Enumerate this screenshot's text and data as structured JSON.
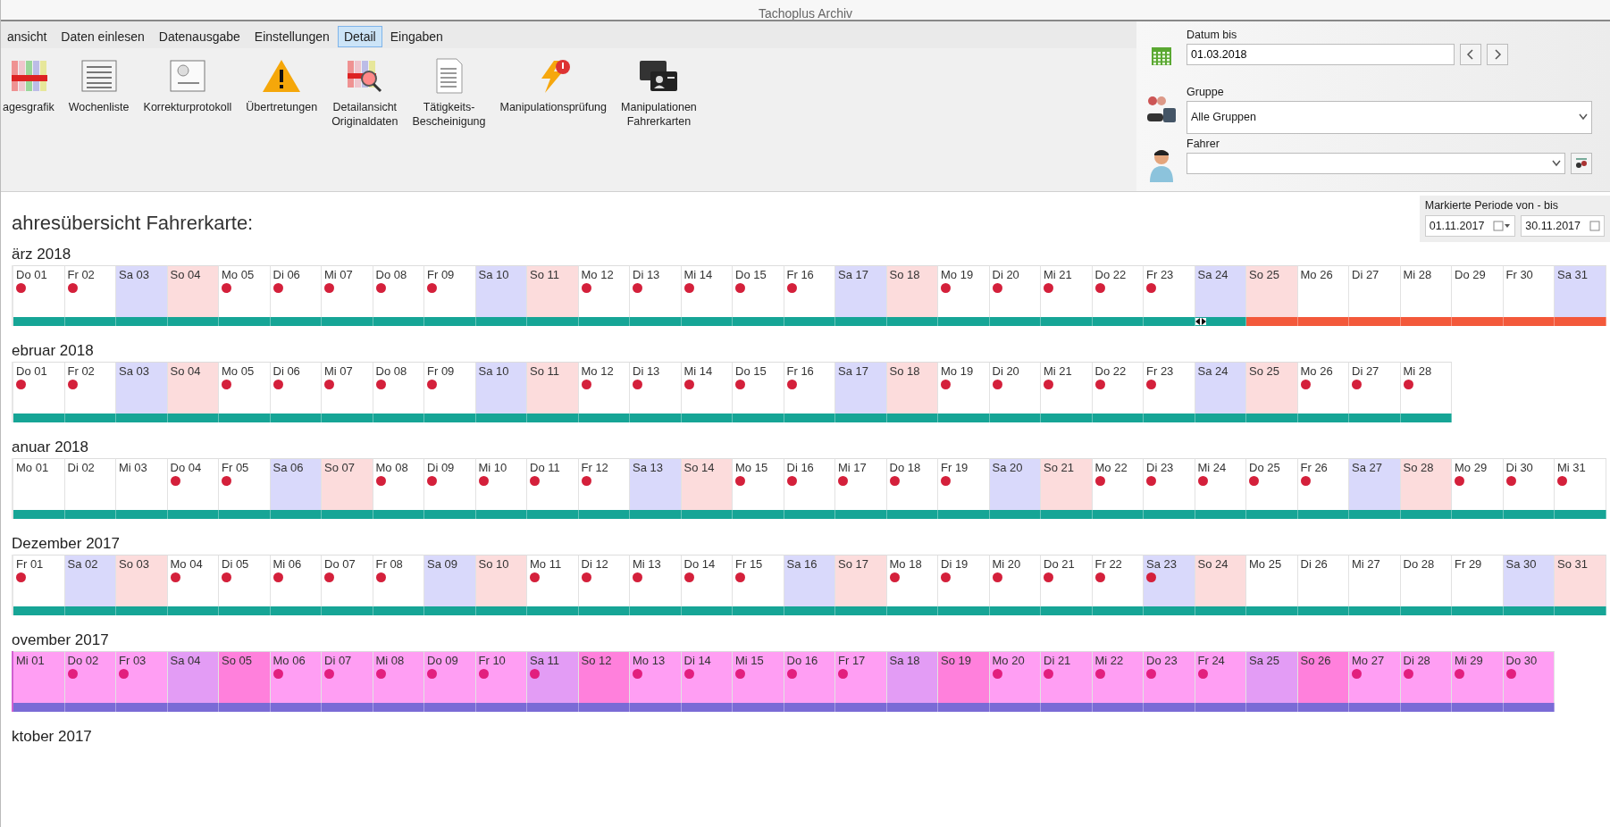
{
  "window": {
    "title": "Tachoplus Archiv"
  },
  "menu_tabs": [
    {
      "label": "ansicht",
      "selected": false
    },
    {
      "label": "Daten einlesen",
      "selected": false
    },
    {
      "label": "Datenausgabe",
      "selected": false
    },
    {
      "label": "Einstellungen",
      "selected": false
    },
    {
      "label": "Detail",
      "selected": true
    },
    {
      "label": "Eingaben",
      "selected": false
    }
  ],
  "toolbar": [
    {
      "kind": "day-chart",
      "lines": [
        "agesgrafik"
      ]
    },
    {
      "kind": "week-list",
      "lines": [
        "Wochenliste"
      ]
    },
    {
      "kind": "correction-log",
      "lines": [
        "Korrekturprotokoll"
      ]
    },
    {
      "kind": "warning",
      "lines": [
        "Übertretungen"
      ]
    },
    {
      "kind": "detail-view",
      "lines": [
        "Detailansicht",
        "Originaldaten"
      ]
    },
    {
      "kind": "certificate",
      "lines": [
        "Tätigkeits-",
        "Bescheinigung"
      ]
    },
    {
      "kind": "manipulation-check",
      "lines": [
        "Manipulationsprüfung"
      ]
    },
    {
      "kind": "driver-cards",
      "lines": [
        "Manipulationen",
        "Fahrerkarten"
      ]
    }
  ],
  "filters": {
    "date_to": {
      "label": "Datum bis",
      "value": "01.03.2018"
    },
    "group": {
      "label": "Gruppe",
      "value": "Alle Gruppen"
    },
    "driver": {
      "label": "Fahrer"
    }
  },
  "period": {
    "label": "Markierte Periode von - bis",
    "from": "01.11.2017",
    "to": "30.11.2017"
  },
  "overview": {
    "title": "ahresübersicht Fahrerkarte:",
    "months": [
      {
        "title": "ärz 2018",
        "marked": false,
        "days": [
          {
            "label": "Do 01",
            "kind": "weekday",
            "alert": true,
            "recorded": true
          },
          {
            "label": "Fr 02",
            "kind": "weekday",
            "alert": true,
            "recorded": true
          },
          {
            "label": "Sa 03",
            "kind": "saturday",
            "alert": false,
            "recorded": true
          },
          {
            "label": "So 04",
            "kind": "sunday",
            "alert": false,
            "recorded": true
          },
          {
            "label": "Mo 05",
            "kind": "weekday",
            "alert": true,
            "recorded": true
          },
          {
            "label": "Di 06",
            "kind": "weekday",
            "alert": true,
            "recorded": true
          },
          {
            "label": "Mi 07",
            "kind": "weekday",
            "alert": true,
            "recorded": true
          },
          {
            "label": "Do 08",
            "kind": "weekday",
            "alert": true,
            "recorded": true
          },
          {
            "label": "Fr 09",
            "kind": "weekday",
            "alert": true,
            "recorded": true
          },
          {
            "label": "Sa 10",
            "kind": "saturday",
            "alert": false,
            "recorded": true
          },
          {
            "label": "So 11",
            "kind": "sunday",
            "alert": false,
            "recorded": true
          },
          {
            "label": "Mo 12",
            "kind": "weekday",
            "alert": true,
            "recorded": true
          },
          {
            "label": "Di 13",
            "kind": "weekday",
            "alert": true,
            "recorded": true
          },
          {
            "label": "Mi 14",
            "kind": "weekday",
            "alert": true,
            "recorded": true
          },
          {
            "label": "Do 15",
            "kind": "weekday",
            "alert": true,
            "recorded": true
          },
          {
            "label": "Fr 16",
            "kind": "weekday",
            "alert": true,
            "recorded": true
          },
          {
            "label": "Sa 17",
            "kind": "saturday",
            "alert": false,
            "recorded": true
          },
          {
            "label": "So 18",
            "kind": "sunday",
            "alert": false,
            "recorded": true
          },
          {
            "label": "Mo 19",
            "kind": "weekday",
            "alert": true,
            "recorded": true
          },
          {
            "label": "Di 20",
            "kind": "weekday",
            "alert": true,
            "recorded": true
          },
          {
            "label": "Mi 21",
            "kind": "weekday",
            "alert": true,
            "recorded": true
          },
          {
            "label": "Do 22",
            "kind": "weekday",
            "alert": true,
            "recorded": true
          },
          {
            "label": "Fr 23",
            "kind": "weekday",
            "alert": true,
            "recorded": true
          },
          {
            "label": "Sa 24",
            "kind": "saturday",
            "alert": false,
            "recorded": true,
            "transition": true
          },
          {
            "label": "So 25",
            "kind": "sunday",
            "alert": false,
            "recorded": false
          },
          {
            "label": "Mo 26",
            "kind": "weekday",
            "alert": false,
            "recorded": false
          },
          {
            "label": "Di 27",
            "kind": "weekday",
            "alert": false,
            "recorded": false
          },
          {
            "label": "Mi 28",
            "kind": "weekday",
            "alert": false,
            "recorded": false
          },
          {
            "label": "Do 29",
            "kind": "weekday",
            "alert": false,
            "recorded": false
          },
          {
            "label": "Fr 30",
            "kind": "weekday",
            "alert": false,
            "recorded": false
          },
          {
            "label": "Sa 31",
            "kind": "saturday",
            "alert": false,
            "recorded": false
          }
        ]
      },
      {
        "title": "ebruar 2018",
        "marked": false,
        "days": [
          {
            "label": "Do 01",
            "kind": "weekday",
            "alert": true,
            "recorded": true
          },
          {
            "label": "Fr 02",
            "kind": "weekday",
            "alert": true,
            "recorded": true
          },
          {
            "label": "Sa 03",
            "kind": "saturday",
            "alert": false,
            "recorded": true
          },
          {
            "label": "So 04",
            "kind": "sunday",
            "alert": false,
            "recorded": true
          },
          {
            "label": "Mo 05",
            "kind": "weekday",
            "alert": true,
            "recorded": true
          },
          {
            "label": "Di 06",
            "kind": "weekday",
            "alert": true,
            "recorded": true
          },
          {
            "label": "Mi 07",
            "kind": "weekday",
            "alert": true,
            "recorded": true
          },
          {
            "label": "Do 08",
            "kind": "weekday",
            "alert": true,
            "recorded": true
          },
          {
            "label": "Fr 09",
            "kind": "weekday",
            "alert": true,
            "recorded": true
          },
          {
            "label": "Sa 10",
            "kind": "saturday",
            "alert": false,
            "recorded": true
          },
          {
            "label": "So 11",
            "kind": "sunday",
            "alert": false,
            "recorded": true
          },
          {
            "label": "Mo 12",
            "kind": "weekday",
            "alert": true,
            "recorded": true
          },
          {
            "label": "Di 13",
            "kind": "weekday",
            "alert": true,
            "recorded": true
          },
          {
            "label": "Mi 14",
            "kind": "weekday",
            "alert": true,
            "recorded": true
          },
          {
            "label": "Do 15",
            "kind": "weekday",
            "alert": true,
            "recorded": true
          },
          {
            "label": "Fr 16",
            "kind": "weekday",
            "alert": true,
            "recorded": true
          },
          {
            "label": "Sa 17",
            "kind": "saturday",
            "alert": false,
            "recorded": true
          },
          {
            "label": "So 18",
            "kind": "sunday",
            "alert": false,
            "recorded": true
          },
          {
            "label": "Mo 19",
            "kind": "weekday",
            "alert": true,
            "recorded": true
          },
          {
            "label": "Di 20",
            "kind": "weekday",
            "alert": true,
            "recorded": true
          },
          {
            "label": "Mi 21",
            "kind": "weekday",
            "alert": true,
            "recorded": true
          },
          {
            "label": "Do 22",
            "kind": "weekday",
            "alert": true,
            "recorded": true
          },
          {
            "label": "Fr 23",
            "kind": "weekday",
            "alert": true,
            "recorded": true
          },
          {
            "label": "Sa 24",
            "kind": "saturday",
            "alert": false,
            "recorded": true
          },
          {
            "label": "So 25",
            "kind": "sunday",
            "alert": false,
            "recorded": true
          },
          {
            "label": "Mo 26",
            "kind": "weekday",
            "alert": true,
            "recorded": true
          },
          {
            "label": "Di 27",
            "kind": "weekday",
            "alert": true,
            "recorded": true
          },
          {
            "label": "Mi 28",
            "kind": "weekday",
            "alert": true,
            "recorded": true
          }
        ]
      },
      {
        "title": "anuar 2018",
        "marked": false,
        "days": [
          {
            "label": "Mo 01",
            "kind": "weekday",
            "alert": false,
            "recorded": true
          },
          {
            "label": "Di 02",
            "kind": "weekday",
            "alert": false,
            "recorded": true
          },
          {
            "label": "Mi 03",
            "kind": "weekday",
            "alert": false,
            "recorded": true
          },
          {
            "label": "Do 04",
            "kind": "weekday",
            "alert": true,
            "recorded": true
          },
          {
            "label": "Fr 05",
            "kind": "weekday",
            "alert": true,
            "recorded": true
          },
          {
            "label": "Sa 06",
            "kind": "saturday",
            "alert": false,
            "recorded": true
          },
          {
            "label": "So 07",
            "kind": "sunday",
            "alert": false,
            "recorded": true
          },
          {
            "label": "Mo 08",
            "kind": "weekday",
            "alert": true,
            "recorded": true
          },
          {
            "label": "Di 09",
            "kind": "weekday",
            "alert": true,
            "recorded": true
          },
          {
            "label": "Mi 10",
            "kind": "weekday",
            "alert": true,
            "recorded": true
          },
          {
            "label": "Do 11",
            "kind": "weekday",
            "alert": true,
            "recorded": true
          },
          {
            "label": "Fr 12",
            "kind": "weekday",
            "alert": true,
            "recorded": true
          },
          {
            "label": "Sa 13",
            "kind": "saturday",
            "alert": false,
            "recorded": true
          },
          {
            "label": "So 14",
            "kind": "sunday",
            "alert": false,
            "recorded": true
          },
          {
            "label": "Mo 15",
            "kind": "weekday",
            "alert": true,
            "recorded": true
          },
          {
            "label": "Di 16",
            "kind": "weekday",
            "alert": true,
            "recorded": true
          },
          {
            "label": "Mi 17",
            "kind": "weekday",
            "alert": true,
            "recorded": true
          },
          {
            "label": "Do 18",
            "kind": "weekday",
            "alert": true,
            "recorded": true
          },
          {
            "label": "Fr 19",
            "kind": "weekday",
            "alert": true,
            "recorded": true
          },
          {
            "label": "Sa 20",
            "kind": "saturday",
            "alert": false,
            "recorded": true
          },
          {
            "label": "So 21",
            "kind": "sunday",
            "alert": false,
            "recorded": true
          },
          {
            "label": "Mo 22",
            "kind": "weekday",
            "alert": true,
            "recorded": true
          },
          {
            "label": "Di 23",
            "kind": "weekday",
            "alert": true,
            "recorded": true
          },
          {
            "label": "Mi 24",
            "kind": "weekday",
            "alert": true,
            "recorded": true
          },
          {
            "label": "Do 25",
            "kind": "weekday",
            "alert": true,
            "recorded": true
          },
          {
            "label": "Fr 26",
            "kind": "weekday",
            "alert": true,
            "recorded": true
          },
          {
            "label": "Sa 27",
            "kind": "saturday",
            "alert": false,
            "recorded": true
          },
          {
            "label": "So 28",
            "kind": "sunday",
            "alert": false,
            "recorded": true
          },
          {
            "label": "Mo 29",
            "kind": "weekday",
            "alert": true,
            "recorded": true
          },
          {
            "label": "Di 30",
            "kind": "weekday",
            "alert": true,
            "recorded": true
          },
          {
            "label": "Mi 31",
            "kind": "weekday",
            "alert": true,
            "recorded": true
          }
        ]
      },
      {
        "title": "Dezember 2017",
        "marked": false,
        "days": [
          {
            "label": "Fr 01",
            "kind": "weekday",
            "alert": true,
            "recorded": true
          },
          {
            "label": "Sa 02",
            "kind": "saturday",
            "alert": false,
            "recorded": true
          },
          {
            "label": "So 03",
            "kind": "sunday",
            "alert": false,
            "recorded": true
          },
          {
            "label": "Mo 04",
            "kind": "weekday",
            "alert": true,
            "recorded": true
          },
          {
            "label": "Di 05",
            "kind": "weekday",
            "alert": true,
            "recorded": true
          },
          {
            "label": "Mi 06",
            "kind": "weekday",
            "alert": true,
            "recorded": true
          },
          {
            "label": "Do 07",
            "kind": "weekday",
            "alert": true,
            "recorded": true
          },
          {
            "label": "Fr 08",
            "kind": "weekday",
            "alert": true,
            "recorded": true
          },
          {
            "label": "Sa 09",
            "kind": "saturday",
            "alert": false,
            "recorded": true
          },
          {
            "label": "So 10",
            "kind": "sunday",
            "alert": false,
            "recorded": true
          },
          {
            "label": "Mo 11",
            "kind": "weekday",
            "alert": true,
            "recorded": true
          },
          {
            "label": "Di 12",
            "kind": "weekday",
            "alert": true,
            "recorded": true
          },
          {
            "label": "Mi 13",
            "kind": "weekday",
            "alert": true,
            "recorded": true
          },
          {
            "label": "Do 14",
            "kind": "weekday",
            "alert": true,
            "recorded": true
          },
          {
            "label": "Fr 15",
            "kind": "weekday",
            "alert": true,
            "recorded": true
          },
          {
            "label": "Sa 16",
            "kind": "saturday",
            "alert": false,
            "recorded": true
          },
          {
            "label": "So 17",
            "kind": "sunday",
            "alert": false,
            "recorded": true
          },
          {
            "label": "Mo 18",
            "kind": "weekday",
            "alert": true,
            "recorded": true
          },
          {
            "label": "Di 19",
            "kind": "weekday",
            "alert": true,
            "recorded": true
          },
          {
            "label": "Mi 20",
            "kind": "weekday",
            "alert": true,
            "recorded": true
          },
          {
            "label": "Do 21",
            "kind": "weekday",
            "alert": true,
            "recorded": true
          },
          {
            "label": "Fr 22",
            "kind": "weekday",
            "alert": true,
            "recorded": true
          },
          {
            "label": "Sa 23",
            "kind": "saturday",
            "alert": true,
            "recorded": true
          },
          {
            "label": "So 24",
            "kind": "sunday",
            "alert": false,
            "recorded": true
          },
          {
            "label": "Mo 25",
            "kind": "weekday",
            "alert": false,
            "recorded": true
          },
          {
            "label": "Di 26",
            "kind": "weekday",
            "alert": false,
            "recorded": true
          },
          {
            "label": "Mi 27",
            "kind": "weekday",
            "alert": false,
            "recorded": true
          },
          {
            "label": "Do 28",
            "kind": "weekday",
            "alert": false,
            "recorded": true
          },
          {
            "label": "Fr 29",
            "kind": "weekday",
            "alert": false,
            "recorded": true
          },
          {
            "label": "Sa 30",
            "kind": "saturday",
            "alert": false,
            "recorded": true
          },
          {
            "label": "So 31",
            "kind": "sunday",
            "alert": false,
            "recorded": true
          }
        ]
      },
      {
        "title": "ovember 2017",
        "marked": true,
        "days": [
          {
            "label": "Mi 01",
            "kind": "weekday",
            "alert": false,
            "recorded": true
          },
          {
            "label": "Do 02",
            "kind": "weekday",
            "alert": true,
            "recorded": true
          },
          {
            "label": "Fr 03",
            "kind": "weekday",
            "alert": true,
            "recorded": true
          },
          {
            "label": "Sa 04",
            "kind": "saturday",
            "alert": false,
            "recorded": true
          },
          {
            "label": "So 05",
            "kind": "sunday",
            "alert": false,
            "recorded": true
          },
          {
            "label": "Mo 06",
            "kind": "weekday",
            "alert": true,
            "recorded": true
          },
          {
            "label": "Di 07",
            "kind": "weekday",
            "alert": true,
            "recorded": true
          },
          {
            "label": "Mi 08",
            "kind": "weekday",
            "alert": true,
            "recorded": true
          },
          {
            "label": "Do 09",
            "kind": "weekday",
            "alert": true,
            "recorded": true
          },
          {
            "label": "Fr 10",
            "kind": "weekday",
            "alert": true,
            "recorded": true
          },
          {
            "label": "Sa 11",
            "kind": "saturday",
            "alert": true,
            "recorded": true
          },
          {
            "label": "So 12",
            "kind": "sunday",
            "alert": false,
            "recorded": true
          },
          {
            "label": "Mo 13",
            "kind": "weekday",
            "alert": true,
            "recorded": true
          },
          {
            "label": "Di 14",
            "kind": "weekday",
            "alert": true,
            "recorded": true
          },
          {
            "label": "Mi 15",
            "kind": "weekday",
            "alert": true,
            "recorded": true
          },
          {
            "label": "Do 16",
            "kind": "weekday",
            "alert": true,
            "recorded": true
          },
          {
            "label": "Fr 17",
            "kind": "weekday",
            "alert": true,
            "recorded": true
          },
          {
            "label": "Sa 18",
            "kind": "saturday",
            "alert": false,
            "recorded": true
          },
          {
            "label": "So 19",
            "kind": "sunday",
            "alert": false,
            "recorded": true
          },
          {
            "label": "Mo 20",
            "kind": "weekday",
            "alert": true,
            "recorded": true
          },
          {
            "label": "Di 21",
            "kind": "weekday",
            "alert": true,
            "recorded": true
          },
          {
            "label": "Mi 22",
            "kind": "weekday",
            "alert": true,
            "recorded": true
          },
          {
            "label": "Do 23",
            "kind": "weekday",
            "alert": true,
            "recorded": true
          },
          {
            "label": "Fr 24",
            "kind": "weekday",
            "alert": true,
            "recorded": true
          },
          {
            "label": "Sa 25",
            "kind": "saturday",
            "alert": false,
            "recorded": true
          },
          {
            "label": "So 26",
            "kind": "sunday",
            "alert": false,
            "recorded": true
          },
          {
            "label": "Mo 27",
            "kind": "weekday",
            "alert": true,
            "recorded": true
          },
          {
            "label": "Di 28",
            "kind": "weekday",
            "alert": true,
            "recorded": true
          },
          {
            "label": "Mi 29",
            "kind": "weekday",
            "alert": true,
            "recorded": true
          },
          {
            "label": "Do 30",
            "kind": "weekday",
            "alert": true,
            "recorded": true
          }
        ]
      },
      {
        "title": "ktober 2017"
      }
    ]
  }
}
